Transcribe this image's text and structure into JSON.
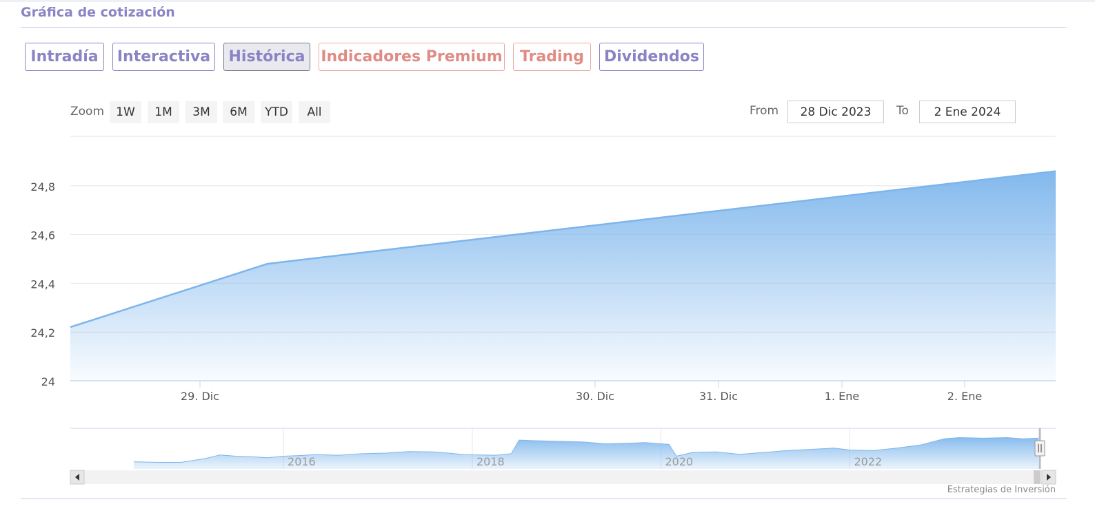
{
  "section": {
    "title": "Gráfica de cotización"
  },
  "tabs": [
    {
      "label": "Intradía",
      "style": "default"
    },
    {
      "label": "Interactiva",
      "style": "default"
    },
    {
      "label": "Histórica",
      "style": "active"
    },
    {
      "label": "Indicadores Premium",
      "style": "premium"
    },
    {
      "label": "Trading",
      "style": "premium"
    },
    {
      "label": "Dividendos",
      "style": "default"
    }
  ],
  "zoom": {
    "label": "Zoom",
    "buttons": [
      "1W",
      "1M",
      "3M",
      "6M",
      "YTD",
      "All"
    ]
  },
  "range": {
    "from_label": "From",
    "from_value": "28 Dic 2023",
    "to_label": "To",
    "to_value": "2 Ene 2024"
  },
  "credits": "Estrategias de Inversión",
  "colors": {
    "accent": "#8a84c4",
    "premium": "#e08c86",
    "series_line": "#7cb5ec",
    "series_fill_top": "#7cb5ec"
  },
  "chart_data": {
    "type": "area",
    "title": "",
    "xlabel": "",
    "ylabel": "",
    "x_range": [
      "2023-12-28",
      "2024-01-02"
    ],
    "ylim": [
      24,
      24.9
    ],
    "y_ticks": [
      24,
      24.2,
      24.4,
      24.6,
      24.8
    ],
    "y_tick_labels": [
      "24",
      "24,2",
      "24,4",
      "24,6",
      "24,8"
    ],
    "x_ticks": [
      {
        "date": "2023-12-29",
        "label": "29. Dic"
      },
      {
        "date": "2023-12-30",
        "label": "30. Dic"
      },
      {
        "date": "2023-12-31",
        "label": "31. Dic"
      },
      {
        "date": "2024-01-01",
        "label": "1. Ene"
      },
      {
        "date": "2024-01-02",
        "label": "2. Ene"
      }
    ],
    "grid": true,
    "legend": "none",
    "series": [
      {
        "points": [
          {
            "x": "2023-12-28",
            "y": 24.22
          },
          {
            "x": "2023-12-29",
            "y": 24.48
          },
          {
            "x": "2024-01-02",
            "y": 24.86
          }
        ]
      }
    ],
    "navigator": {
      "x_ticks": [
        {
          "date": "2016-01-01",
          "label": "2016"
        },
        {
          "date": "2018-01-01",
          "label": "2018"
        },
        {
          "date": "2020-01-01",
          "label": "2020"
        },
        {
          "date": "2022-01-01",
          "label": "2022"
        }
      ],
      "series": [
        {
          "x": "2014-06",
          "y": 0.12
        },
        {
          "x": "2014-09",
          "y": 0.1
        },
        {
          "x": "2014-12",
          "y": 0.1
        },
        {
          "x": "2015-03",
          "y": 0.22
        },
        {
          "x": "2015-05",
          "y": 0.34
        },
        {
          "x": "2015-07",
          "y": 0.3
        },
        {
          "x": "2015-09",
          "y": 0.28
        },
        {
          "x": "2015-11",
          "y": 0.25
        },
        {
          "x": "2016-01",
          "y": 0.3
        },
        {
          "x": "2016-03",
          "y": 0.32
        },
        {
          "x": "2016-05",
          "y": 0.35
        },
        {
          "x": "2016-08",
          "y": 0.33
        },
        {
          "x": "2016-11",
          "y": 0.38
        },
        {
          "x": "2017-02",
          "y": 0.4
        },
        {
          "x": "2017-05",
          "y": 0.45
        },
        {
          "x": "2017-08",
          "y": 0.44
        },
        {
          "x": "2017-10",
          "y": 0.4
        },
        {
          "x": "2017-12",
          "y": 0.35
        },
        {
          "x": "2018-02",
          "y": 0.34
        },
        {
          "x": "2018-04",
          "y": 0.33
        },
        {
          "x": "2018-06",
          "y": 0.38
        },
        {
          "x": "2018-07",
          "y": 0.82
        },
        {
          "x": "2018-09",
          "y": 0.8
        },
        {
          "x": "2018-12",
          "y": 0.78
        },
        {
          "x": "2019-03",
          "y": 0.76
        },
        {
          "x": "2019-06",
          "y": 0.7
        },
        {
          "x": "2019-09",
          "y": 0.72
        },
        {
          "x": "2019-11",
          "y": 0.74
        },
        {
          "x": "2020-01",
          "y": 0.7
        },
        {
          "x": "2020-02",
          "y": 0.68
        },
        {
          "x": "2020-03",
          "y": 0.3
        },
        {
          "x": "2020-05",
          "y": 0.42
        },
        {
          "x": "2020-08",
          "y": 0.44
        },
        {
          "x": "2020-11",
          "y": 0.36
        },
        {
          "x": "2021-02",
          "y": 0.42
        },
        {
          "x": "2021-05",
          "y": 0.48
        },
        {
          "x": "2021-08",
          "y": 0.52
        },
        {
          "x": "2021-11",
          "y": 0.56
        },
        {
          "x": "2022-01",
          "y": 0.5
        },
        {
          "x": "2022-04",
          "y": 0.48
        },
        {
          "x": "2022-07",
          "y": 0.56
        },
        {
          "x": "2022-10",
          "y": 0.66
        },
        {
          "x": "2023-01",
          "y": 0.86
        },
        {
          "x": "2023-03",
          "y": 0.9
        },
        {
          "x": "2023-06",
          "y": 0.88
        },
        {
          "x": "2023-09",
          "y": 0.9
        },
        {
          "x": "2023-11",
          "y": 0.86
        },
        {
          "x": "2024-01",
          "y": 0.88
        }
      ]
    }
  }
}
